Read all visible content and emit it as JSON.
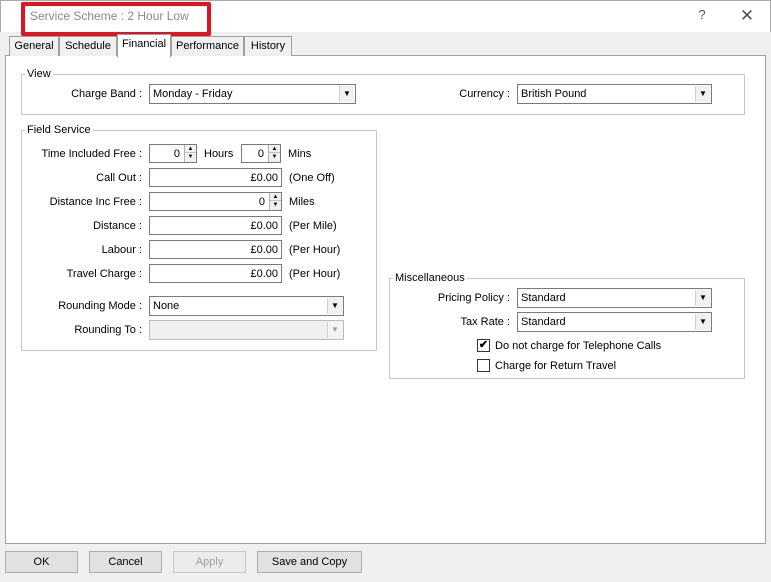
{
  "window": {
    "title": "Service Scheme : 2 Hour Low",
    "help_glyph": "?",
    "close_glyph": "✕"
  },
  "tabs": [
    "General",
    "Schedule",
    "Financial",
    "Performance",
    "History"
  ],
  "active_tab": "Financial",
  "view": {
    "group_title": "View",
    "charge_band_label": "Charge Band :",
    "charge_band_value": "Monday - Friday",
    "currency_label": "Currency :",
    "currency_value": "British Pound"
  },
  "field_service": {
    "group_title": "Field Service",
    "time_included_free_label": "Time Included Free :",
    "hours_value": "0",
    "hours_label": "Hours",
    "mins_value": "0",
    "mins_label": "Mins",
    "call_out_label": "Call Out :",
    "call_out_value": "£0.00",
    "call_out_suffix": "(One Off)",
    "distance_inc_free_label": "Distance Inc Free :",
    "distance_inc_free_value": "0",
    "distance_inc_free_suffix": "Miles",
    "distance_label": "Distance :",
    "distance_value": "£0.00",
    "distance_suffix": "(Per Mile)",
    "labour_label": "Labour :",
    "labour_value": "£0.00",
    "labour_suffix": "(Per Hour)",
    "travel_charge_label": "Travel Charge :",
    "travel_charge_value": "£0.00",
    "travel_charge_suffix": "(Per Hour)",
    "rounding_mode_label": "Rounding Mode :",
    "rounding_mode_value": "None",
    "rounding_to_label": "Rounding To :",
    "rounding_to_value": ""
  },
  "miscellaneous": {
    "group_title": "Miscellaneous",
    "pricing_policy_label": "Pricing Policy :",
    "pricing_policy_value": "Standard",
    "tax_rate_label": "Tax Rate :",
    "tax_rate_value": "Standard",
    "no_phone_charge_label": "Do not charge for Telephone Calls",
    "no_phone_charge_checked": true,
    "return_travel_label": "Charge for Return Travel",
    "return_travel_checked": false,
    "check_glyph": "✔"
  },
  "buttons": {
    "ok": "OK",
    "cancel": "Cancel",
    "apply": "Apply",
    "save_copy": "Save and Copy"
  },
  "icons": {
    "dropdown": "chevron-down-icon",
    "spin_up": "▲",
    "spin_down": "▼",
    "arrow": "▼"
  },
  "colors": {
    "highlight": "#e0141e",
    "title_text": "#8a8a8a"
  }
}
